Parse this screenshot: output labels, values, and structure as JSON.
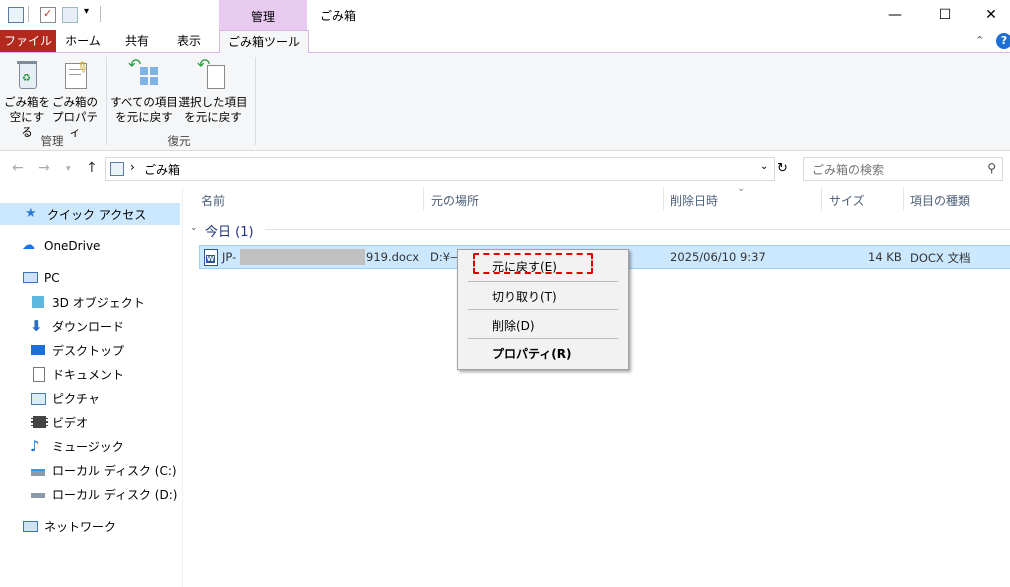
{
  "window": {
    "title": "ごみ箱",
    "context_tab_group": "管理",
    "controls": {
      "minimize": "—",
      "maximize": "☐",
      "close": "✕"
    }
  },
  "tabs": {
    "file": "ファイル",
    "home": "ホーム",
    "share": "共有",
    "view": "表示",
    "recycle_tools": "ごみ箱ツール"
  },
  "ribbon": {
    "empty_bin": {
      "line1": "ごみ箱を",
      "line2": "空にする"
    },
    "properties": {
      "line1": "ごみ箱の",
      "line2": "プロパティ"
    },
    "group_manage": "管理",
    "restore_all": {
      "line1": "すべての項目",
      "line2": "を元に戻す"
    },
    "restore_selected": {
      "line1": "選択した項目",
      "line2": "を元に戻す"
    },
    "group_restore": "復元"
  },
  "address": {
    "path": "ごみ箱",
    "search_placeholder": "ごみ箱の検索"
  },
  "nav": {
    "quick_access": "クイック アクセス",
    "onedrive": "OneDrive",
    "pc": "PC",
    "objects3d": "3D オブジェクト",
    "downloads": "ダウンロード",
    "desktop": "デスクトップ",
    "documents": "ドキュメント",
    "pictures": "ピクチャ",
    "videos": "ビデオ",
    "music": "ミュージック",
    "disk_c": "ローカル ディスク (C:)",
    "disk_d": "ローカル ディスク (D:)",
    "network": "ネットワーク"
  },
  "columns": {
    "name": "名前",
    "original_location": "元の場所",
    "date_deleted": "削除日時",
    "size": "サイズ",
    "type": "項目の種類"
  },
  "group": {
    "label": "今日 (1)"
  },
  "file": {
    "name_prefix": "JP-",
    "name_suffix": "919.docx",
    "location": "D:¥—",
    "date_deleted": "2025/06/10 9:37",
    "size": "14 KB",
    "type": "DOCX 文档"
  },
  "context_menu": {
    "restore": "元に戻す(E)",
    "cut": "切り取り(T)",
    "delete": "削除(D)",
    "properties": "プロパティ(R)"
  },
  "colors": {
    "file_tab": "#b3291e",
    "context_tab": "#e8c9f0",
    "selection": "#cce8ff",
    "highlight_box": "#e00000"
  }
}
